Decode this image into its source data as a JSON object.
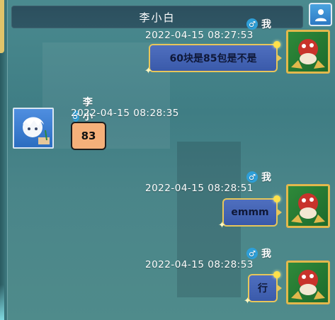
{
  "window": {
    "title": "李小白"
  },
  "messages": [
    {
      "sender": "我",
      "gender": "♂",
      "time": "2022-04-15  08:27:53",
      "text": "60块是85包是不是",
      "side": "right"
    },
    {
      "sender": "李小白",
      "gender": "♂",
      "time": "2022-04-15  08:28:35",
      "text": "83",
      "side": "left"
    },
    {
      "sender": "我",
      "gender": "♂",
      "time": "2022-04-15  08:28:51",
      "text": "emmm",
      "side": "right"
    },
    {
      "sender": "我",
      "gender": "♂",
      "time": "2022-04-15  08:28:53",
      "text": "行",
      "side": "right"
    }
  ],
  "icons": {
    "gender": "male-icon",
    "profile": "person-icon"
  },
  "colors": {
    "background": "#4a8a8f",
    "title_bar": "#2c4f5e",
    "self_bubble": "#4f6fbf",
    "self_bubble_border": "#e8c65a",
    "other_bubble": "#f5b07a",
    "gender_badge": "#2e9fd8"
  }
}
